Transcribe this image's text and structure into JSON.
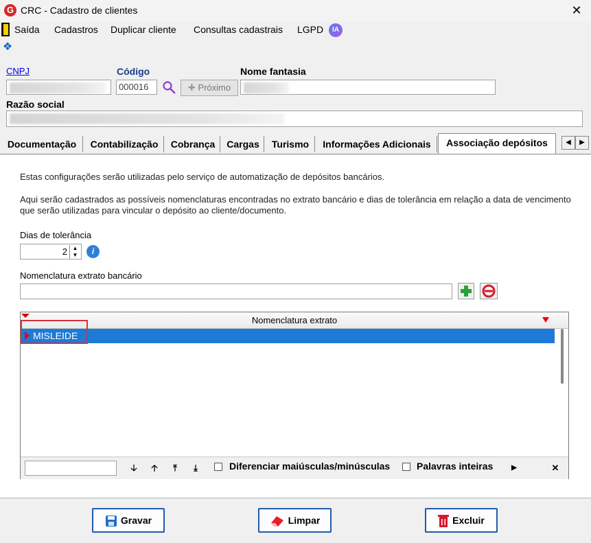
{
  "window": {
    "title": "CRC - Cadastro de clientes",
    "logo": "G",
    "close": "✕"
  },
  "menu": {
    "exit": "Saída",
    "items": [
      "Cadastros",
      "Duplicar cliente",
      "Consultas cadastrais",
      "LGPD"
    ],
    "ia": "IA"
  },
  "form": {
    "cnpj_label": "CNPJ",
    "codigo_label": "Código",
    "codigo_value": "000016",
    "next_button": "Próximo",
    "nome_fantasia_label": "Nome fantasia",
    "razao_social_label": "Razão social"
  },
  "tabs": [
    "Documentação",
    "Contabilização",
    "Cobrança",
    "Cargas",
    "Turismo",
    "Informações Adicionais",
    "Associação depósitos"
  ],
  "panel": {
    "info1": "Estas configurações serão utilizadas pelo serviço de automatização de depósitos bancários.",
    "info2": "Aqui serão cadastrados as possíveis nomenclaturas encontradas no extrato bancário e dias de tolerância em relação a data de vencimento que serão utilizadas para vincular o depósito ao cliente/documento.",
    "dias_label": "Dias de tolerância",
    "dias_value": "2",
    "nomenclatura_label": "Nomenclatura extrato bancário",
    "nomenclatura_value": ""
  },
  "grid": {
    "column": "Nomenclatura extrato",
    "rows": [
      "MISLEIDE"
    ],
    "case_label": "Diferenciar maiúsculas/minúsculas",
    "whole_label": "Palavras inteiras"
  },
  "buttons": {
    "save": "Gravar",
    "clear": "Limpar",
    "delete": "Excluir"
  },
  "colors": {
    "selection": "#1e7ad6",
    "accent": "#1e5aa8",
    "highlight": "#d9303a"
  }
}
